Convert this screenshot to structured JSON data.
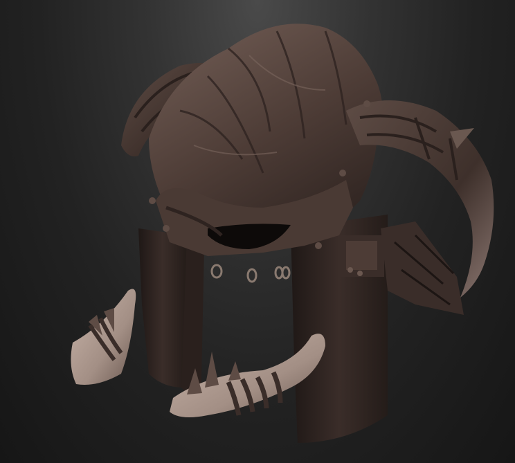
{
  "scene": {
    "subject": "sculpted-helmet-render",
    "colors": {
      "background_top": "#4a4a4a",
      "background_bottom": "#161616",
      "helmet_dark": "#2e2320",
      "helmet_mid": "#4a3a34",
      "helmet_light": "#6b5850",
      "bone": "#a38f85",
      "bone_light": "#c9b5aa",
      "metal_ring": "#8a7a70"
    }
  }
}
